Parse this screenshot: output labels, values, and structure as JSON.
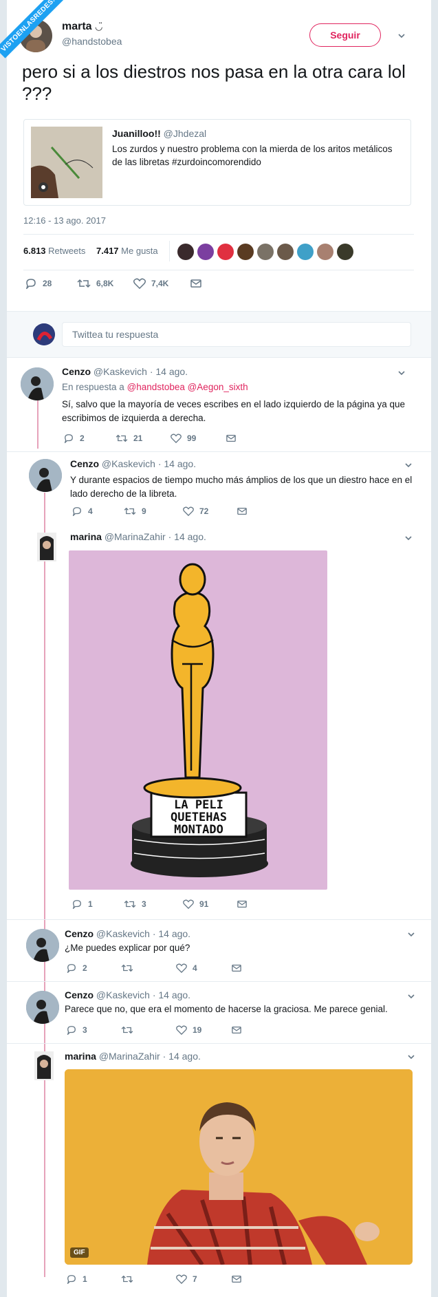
{
  "watermark": "VISTOENLASREDES.COM",
  "main": {
    "name": "marta",
    "name_emoji": "◡̈",
    "handle": "@handstobea",
    "follow_label": "Seguir",
    "text": "pero si a los diestros nos pasa en la otra cara lol ???",
    "quote": {
      "name": "Juanilloo!!",
      "handle": "@Jhdezal",
      "text": "Los zurdos y nuestro problema con la mierda de los aritos metálicos de las libretas #zurdoincomorendido"
    },
    "timestamp": "12:16 - 13 ago. 2017",
    "retweets_count": "6.813",
    "retweets_label": "Retweets",
    "likes_count": "7.417",
    "likes_label": "Me gusta",
    "actions": {
      "replies": "28",
      "retweets": "6,8K",
      "likes": "7,4K"
    }
  },
  "reply_placeholder": "Twittea tu respuesta",
  "replies": [
    {
      "name": "Cenzo",
      "handle": "@Kaskevich",
      "time": "· 14 ago.",
      "in_reply_prefix": "En respuesta a",
      "in_reply_users": "@handstobea @Aegon_sixth",
      "text": "Sí, salvo que la mayoría de veces escribes en el lado izquierdo de la página ya que escribimos de izquierda a derecha.",
      "replies": "2",
      "retweets": "21",
      "likes": "99"
    },
    {
      "name": "Cenzo",
      "handle": "@Kaskevich",
      "time": "· 14 ago.",
      "text": "Y durante espacios de tiempo mucho más ámplios de los que un diestro hace en el lado derecho de la libreta.",
      "replies": "4",
      "retweets": "9",
      "likes": "72"
    },
    {
      "name": "marina",
      "handle": "@MarinaZahir",
      "time": "· 14 ago.",
      "image_text": [
        "LA PELI",
        "QUETEHAS",
        "MONTADO"
      ],
      "replies": "1",
      "retweets": "3",
      "likes": "91"
    },
    {
      "name": "Cenzo",
      "handle": "@Kaskevich",
      "time": "· 14 ago.",
      "text": "¿Me puedes explicar por qué?",
      "replies": "2",
      "retweets": "",
      "likes": "4"
    },
    {
      "name": "Cenzo",
      "handle": "@Kaskevich",
      "time": "· 14 ago.",
      "text": "Parece que no, que era el momento de hacerse la graciosa. Me parece genial.",
      "replies": "3",
      "retweets": "",
      "likes": "19"
    },
    {
      "name": "marina",
      "handle": "@MarinaZahir",
      "time": "· 14 ago.",
      "gif_label": "GIF",
      "replies": "1",
      "retweets": "",
      "likes": "7"
    }
  ],
  "colors": {
    "accent": "#e0245e",
    "muted": "#657786",
    "thread": "#e6a2ba",
    "oscar_bg": "#ddb7d9",
    "gold": "#f3b52b",
    "gif_bg": "#f0b53d"
  }
}
